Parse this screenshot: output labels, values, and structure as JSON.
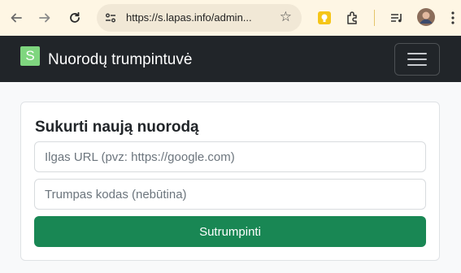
{
  "browser": {
    "url": "https://s.lapas.info/admin...",
    "icons": [
      "back-arrow-icon",
      "forward-arrow-icon",
      "reload-icon",
      "site-settings-icon",
      "bookmark-star-icon",
      "extension-yellow-icon",
      "extensions-puzzle-icon",
      "media-queue-icon",
      "profile-avatar-icon",
      "kebab-menu-icon"
    ]
  },
  "navbar": {
    "brand_letter": "S",
    "title": "Nuorodų trumpintuvė"
  },
  "form": {
    "heading": "Sukurti naują nuorodą",
    "long_url_placeholder": "Ilgas URL (pvz: https://google.com)",
    "short_code_placeholder": "Trumpas kodas (nebūtina)",
    "submit_label": "Sutrumpinti"
  },
  "colors": {
    "browser_bar": "#fef6e4",
    "navbar_bg": "#212529",
    "brand_icon": "#7fd67f",
    "submit_bg": "#198754",
    "page_bg": "#f8f9fa"
  }
}
